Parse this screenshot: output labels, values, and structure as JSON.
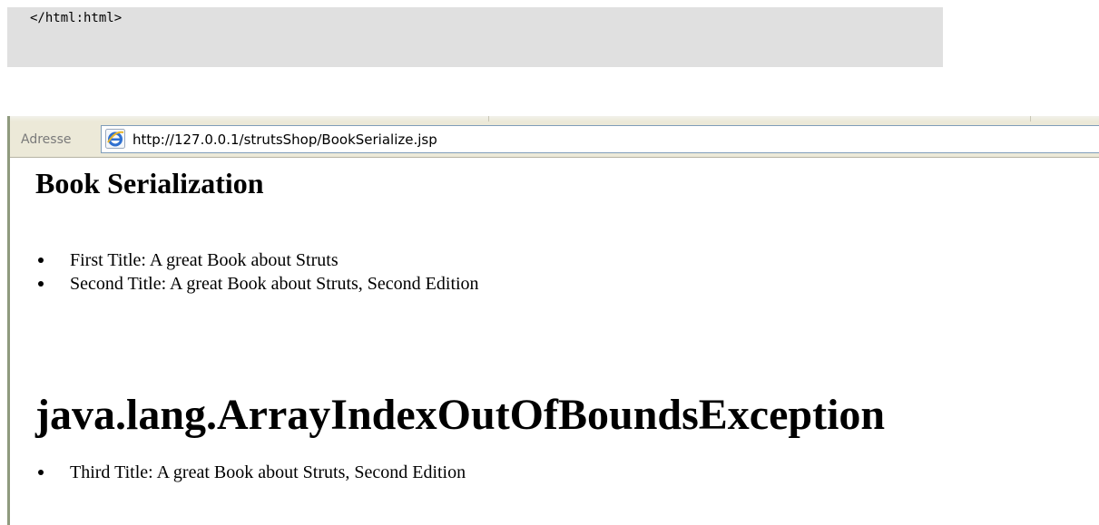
{
  "code_block": {
    "line": "</html:html>"
  },
  "browser": {
    "address_label": "Adresse",
    "url": "http://127.0.0.1/strutsShop/BookSerialize.jsp",
    "address_icon": "internet-explorer-icon"
  },
  "page": {
    "heading": "Book Serialization",
    "first_list": [
      "First Title: A great Book about Struts",
      "Second Title: A great Book about Struts, Second Edition"
    ],
    "exception_heading": "java.lang.ArrayIndexOutOfBoundsException",
    "second_list": [
      "Third Title: A great Book about Struts, Second Edition"
    ]
  },
  "colors": {
    "code_background": "#e0e0e0",
    "toolbar_background": "#ece9d8",
    "address_border": "#7f9db9"
  }
}
